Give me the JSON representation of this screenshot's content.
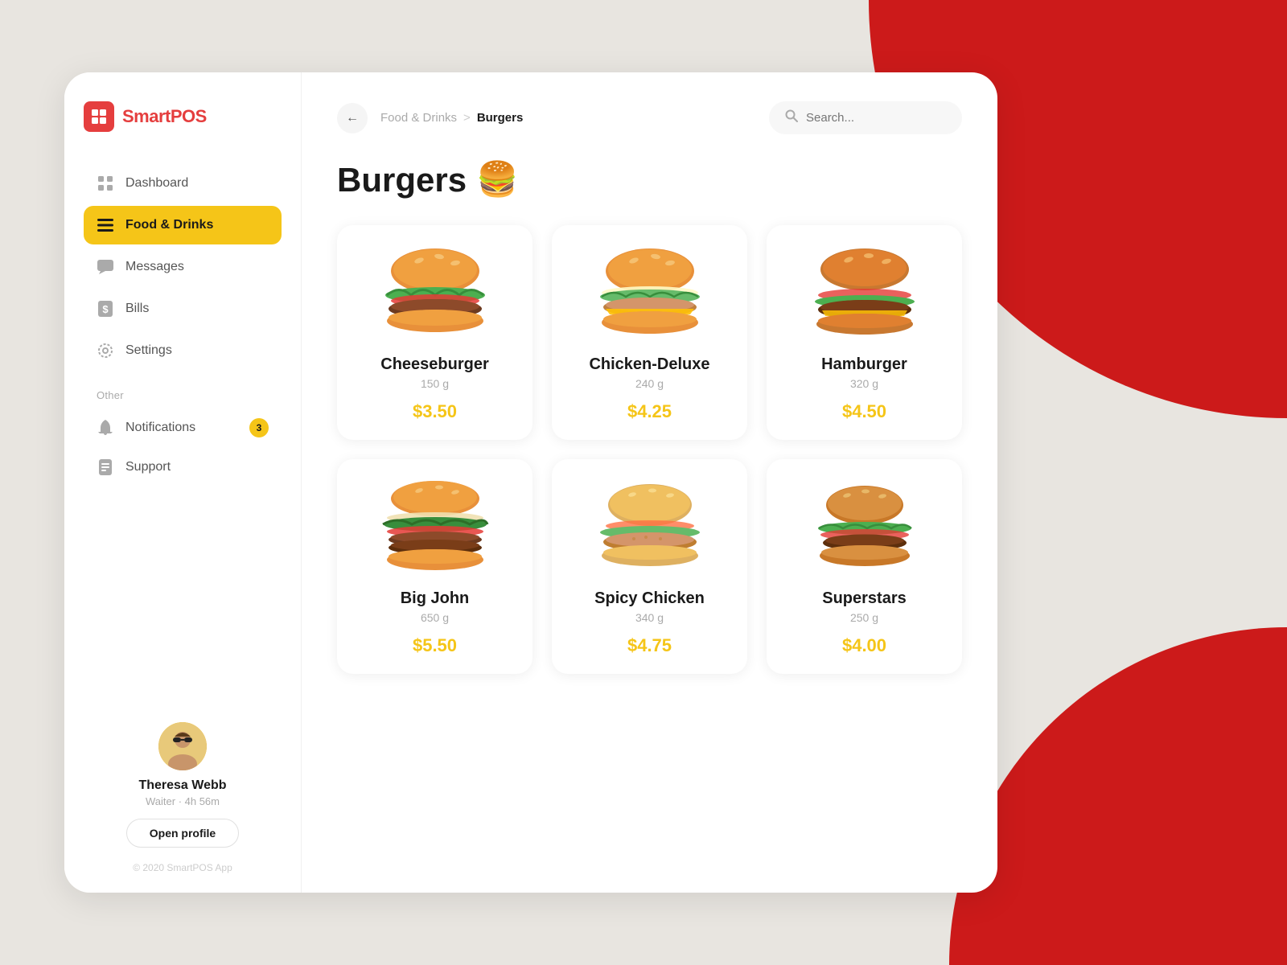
{
  "app": {
    "name_part1": "Smart",
    "name_part2": "POS",
    "copyright": "© 2020 SmartPOS App"
  },
  "sidebar": {
    "nav_items": [
      {
        "id": "dashboard",
        "label": "Dashboard",
        "icon": "⊞",
        "active": false
      },
      {
        "id": "food-drinks",
        "label": "Food & Drinks",
        "icon": "☰",
        "active": true
      },
      {
        "id": "messages",
        "label": "Messages",
        "icon": "💬",
        "active": false
      },
      {
        "id": "bills",
        "label": "Bills",
        "icon": "💲",
        "active": false
      },
      {
        "id": "settings",
        "label": "Settings",
        "icon": "⚙",
        "active": false
      }
    ],
    "section_other_label": "Other",
    "other_items": [
      {
        "id": "notifications",
        "label": "Notifications",
        "icon": "🔔",
        "badge": "3"
      },
      {
        "id": "support",
        "label": "Support",
        "icon": "📋"
      }
    ],
    "user": {
      "name": "Theresa Webb",
      "role": "Waiter",
      "time": "4h 56m",
      "role_time": "Waiter · 4h 56m",
      "open_profile_label": "Open profile"
    }
  },
  "header": {
    "back_label": "←",
    "breadcrumb_parent": "Food & Drinks",
    "breadcrumb_sep": ">",
    "breadcrumb_current": "Burgers",
    "search_placeholder": "Search..."
  },
  "main": {
    "page_title": "Burgers",
    "page_emoji": "🍔",
    "products": [
      {
        "id": "cheeseburger",
        "name": "Cheeseburger",
        "weight": "150 g",
        "price": "$3.50",
        "emoji": "🍔"
      },
      {
        "id": "chicken-deluxe",
        "name": "Chicken-Deluxe",
        "weight": "240 g",
        "price": "$4.25",
        "emoji": "🍔"
      },
      {
        "id": "hamburger",
        "name": "Hamburger",
        "weight": "320 g",
        "price": "$4.50",
        "emoji": "🍔"
      },
      {
        "id": "big-john",
        "name": "Big John",
        "weight": "650 g",
        "price": "$5.50",
        "emoji": "🍔"
      },
      {
        "id": "spicy-chicken",
        "name": "Spicy Chicken",
        "weight": "340 g",
        "price": "$4.75",
        "emoji": "🍔"
      },
      {
        "id": "superstars",
        "name": "Superstars",
        "weight": "250 g",
        "price": "$4.00",
        "emoji": "🍔"
      }
    ]
  },
  "colors": {
    "accent_yellow": "#f5c518",
    "accent_red": "#cc1a1a",
    "text_primary": "#1a1a1a",
    "text_muted": "#aaaaaa"
  }
}
